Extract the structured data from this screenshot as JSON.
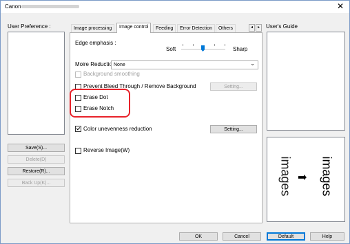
{
  "window": {
    "title": "Canon",
    "close_glyph": "✕"
  },
  "user_preference": {
    "label": "User Preference :",
    "buttons": {
      "save": "Save(S)...",
      "delete": "Delete(D)",
      "restore": "Restore(R)...",
      "backup": "Back Up(K)..."
    }
  },
  "tabs": [
    {
      "label": "Image processing",
      "active": false
    },
    {
      "label": "Image control",
      "active": true
    },
    {
      "label": "Feeding",
      "active": false
    },
    {
      "label": "Error Detection",
      "active": false
    },
    {
      "label": "Others",
      "active": false
    }
  ],
  "tab_nav": {
    "prev": "◂",
    "next": "▸"
  },
  "image_control": {
    "edge_emphasis": {
      "label": "Edge emphasis :",
      "min_label": "Soft",
      "max_label": "Sharp",
      "level_fraction": 0.5
    },
    "moire_reduction": {
      "label": "Moire Reduction :",
      "selected": "None",
      "chevron": "⌄"
    },
    "background_smoothing": {
      "label": "Background smoothing",
      "checked": false,
      "enabled": false
    },
    "prevent_bleed": {
      "label": "Prevent Bleed Through / Remove Background",
      "checked": false,
      "enabled": true
    },
    "setting_disabled": "Setting...",
    "erase_dot": {
      "label": "Erase Dot",
      "checked": false
    },
    "erase_notch": {
      "label": "Erase Notch",
      "checked": false
    },
    "color_unevenness": {
      "label": "Color unevenness reduction",
      "checked": true
    },
    "setting": "Setting...",
    "reverse_image": {
      "label": "Reverse Image(W)",
      "checked": false
    }
  },
  "users_guide": {
    "label": "User's Guide",
    "preview_text_left": "images",
    "preview_text_right": "images",
    "arrow": "➡"
  },
  "footer": {
    "ok": "OK",
    "cancel": "Cancel",
    "default": "Default",
    "help": "Help"
  },
  "colors": {
    "accent": "#0078d7",
    "highlight_ring": "#e8222a"
  }
}
